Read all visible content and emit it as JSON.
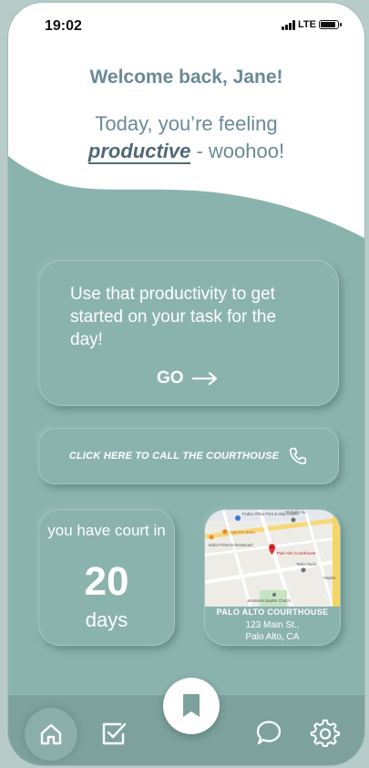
{
  "status_bar": {
    "time": "19:02",
    "network": "LTE"
  },
  "header": {
    "welcome": "Welcome back, Jane!",
    "feeling_prefix": "Today, you’re feeling",
    "mood": "productive",
    "feeling_suffix": "- woohoo!"
  },
  "task_card": {
    "message": "Use that productivity to get started on your task for the day!",
    "go_label": "GO"
  },
  "call_card": {
    "label": "CLICK HERE TO CALL THE COURTHOUSE"
  },
  "court_card": {
    "line1": "you have court in",
    "days": "20",
    "days_label": "days"
  },
  "map_card": {
    "title": "PALO ALTO COURTHOUSE",
    "address_line1": "123 Main St.,",
    "address_line2": "Palo Alto, CA",
    "pins": {
      "fedex": "FedEx Office Print & Ship Center",
      "cafe": "Cafe Pro Bono",
      "pizzeria": "Italico Pizzeria Restaurant",
      "courthouse": "Palo Alto Courthouse",
      "tesla": "Tesla Studio",
      "church": "Jerusalem Baptist Church",
      "globality": "Globality Inc",
      "hopkins": "Hopkin"
    }
  },
  "colors": {
    "background": "#8bb3ae",
    "heading": "#6a8a97",
    "mood": "#4f6a75",
    "map_pin": "#e03131"
  },
  "nav": {
    "items": [
      {
        "icon": "home-icon",
        "active": true
      },
      {
        "icon": "checklist-icon",
        "active": false
      },
      {
        "icon": "bookmark-icon",
        "active": false
      },
      {
        "icon": "chat-icon",
        "active": false
      },
      {
        "icon": "settings-icon",
        "active": false
      }
    ]
  }
}
